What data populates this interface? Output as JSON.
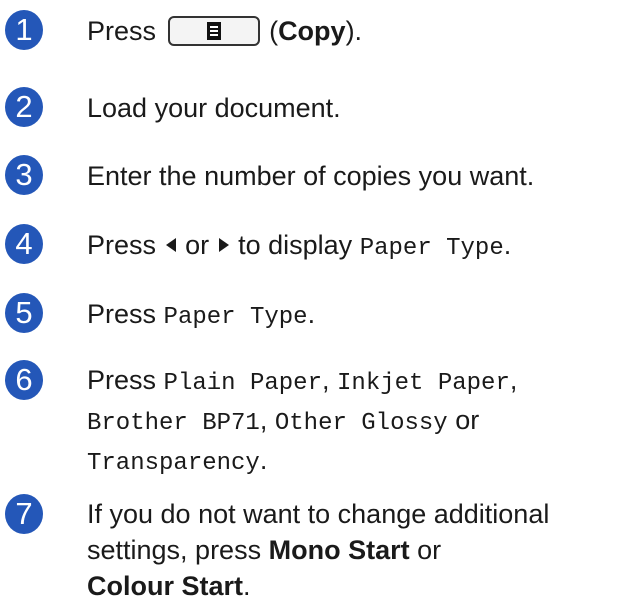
{
  "steps": [
    {
      "number": "1",
      "press": "Press",
      "copy_key_icon": "copy-key-icon",
      "copy_open": "(",
      "copy": "Copy",
      "copy_close": ")."
    },
    {
      "number": "2",
      "text": "Load your document."
    },
    {
      "number": "3",
      "text": "Enter the number of copies you want."
    },
    {
      "number": "4",
      "press": "Press",
      "left_arrow_icon": "left-arrow-icon",
      "or": "or",
      "right_arrow_icon": "right-arrow-icon",
      "to_display": "to display",
      "menu_item": "Paper Type",
      "period": "."
    },
    {
      "number": "5",
      "press": "Press",
      "menu_item": "Paper Type",
      "period": "."
    },
    {
      "number": "6",
      "press": "Press",
      "options": [
        "Plain Paper",
        "Inkjet Paper",
        "Brother BP71",
        "Other Glossy"
      ],
      "comma": ",",
      "or": "or",
      "last_option": "Transparency",
      "period": "."
    },
    {
      "number": "7",
      "text_a": "If you do not want to change additional settings, press",
      "mono_start": "Mono Start",
      "or": "or",
      "colour_start": "Colour Start",
      "period": "."
    }
  ],
  "colors": {
    "step_badge": "#2457b8",
    "text": "#1a1a1a"
  }
}
